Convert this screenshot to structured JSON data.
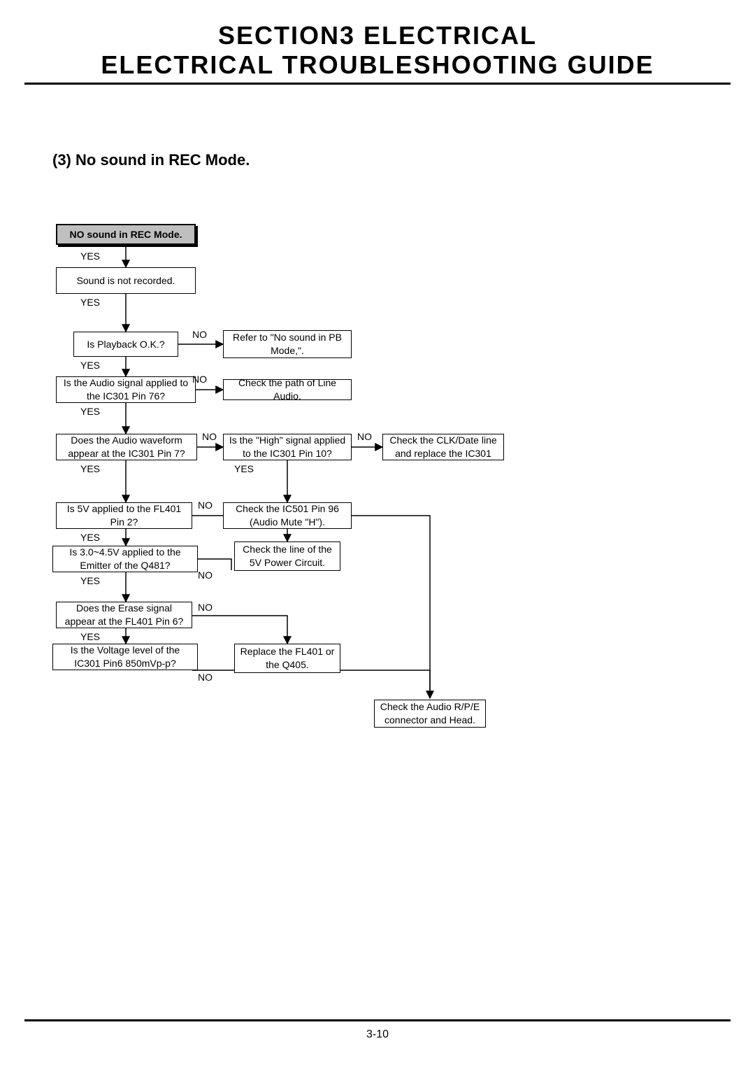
{
  "title1": "SECTION3    ELECTRICAL",
  "title2": "ELECTRICAL TROUBLESHOOTING GUIDE",
  "subtitle": "(3) No sound in REC Mode.",
  "page_num": "3-10",
  "labels": {
    "yes": "YES",
    "no": "NO"
  },
  "boxes": {
    "hdr": "NO sound in REC Mode.",
    "b1": "Sound is not recorded.",
    "b2": "Is Playback O.K.?",
    "b2no": "Refer to \"No sound in PB Mode,\".",
    "b3": "Is the Audio signal applied to the IC301 Pin 76?",
    "b3no": "Check the path of Line Audio.",
    "b4": "Does the Audio waveform appear at the IC301 Pin 7?",
    "b4no": "Is the \"High\" signal applied to the IC301 Pin 10?",
    "b4no_no": "Check the CLK/Date line and replace the IC301",
    "b4no_yes": "Check the IC501 Pin 96 (Audio Mute \"H\").",
    "b5": "Is 5V applied to the FL401 Pin 2?",
    "b5no": "Check the line of the 5V Power Circuit.",
    "b6": "Is 3.0~4.5V applied to the Emitter of the Q481?",
    "b7": "Does the Erase signal appear at the FL401 Pin 6?",
    "b7no": "Replace the FL401 or the Q405.",
    "b8": "Is the Voltage level of the IC301 Pin6 850mVp-p?",
    "final": "Check the Audio R/P/E connector and Head."
  }
}
